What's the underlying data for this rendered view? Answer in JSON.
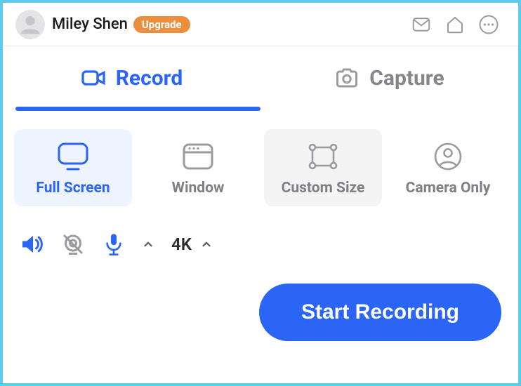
{
  "header": {
    "username": "Miley Shen",
    "upgrade_label": "Upgrade"
  },
  "tabs": {
    "record": "Record",
    "capture": "Capture"
  },
  "modes": {
    "full_screen": "Full Screen",
    "window": "Window",
    "custom_size": "Custom Size",
    "camera_only": "Camera Only"
  },
  "controls": {
    "quality": "4K"
  },
  "actions": {
    "start": "Start Recording"
  },
  "colors": {
    "accent": "#2B65F6",
    "upgrade": "#EC8E3D",
    "border": "#5DCBEC"
  }
}
